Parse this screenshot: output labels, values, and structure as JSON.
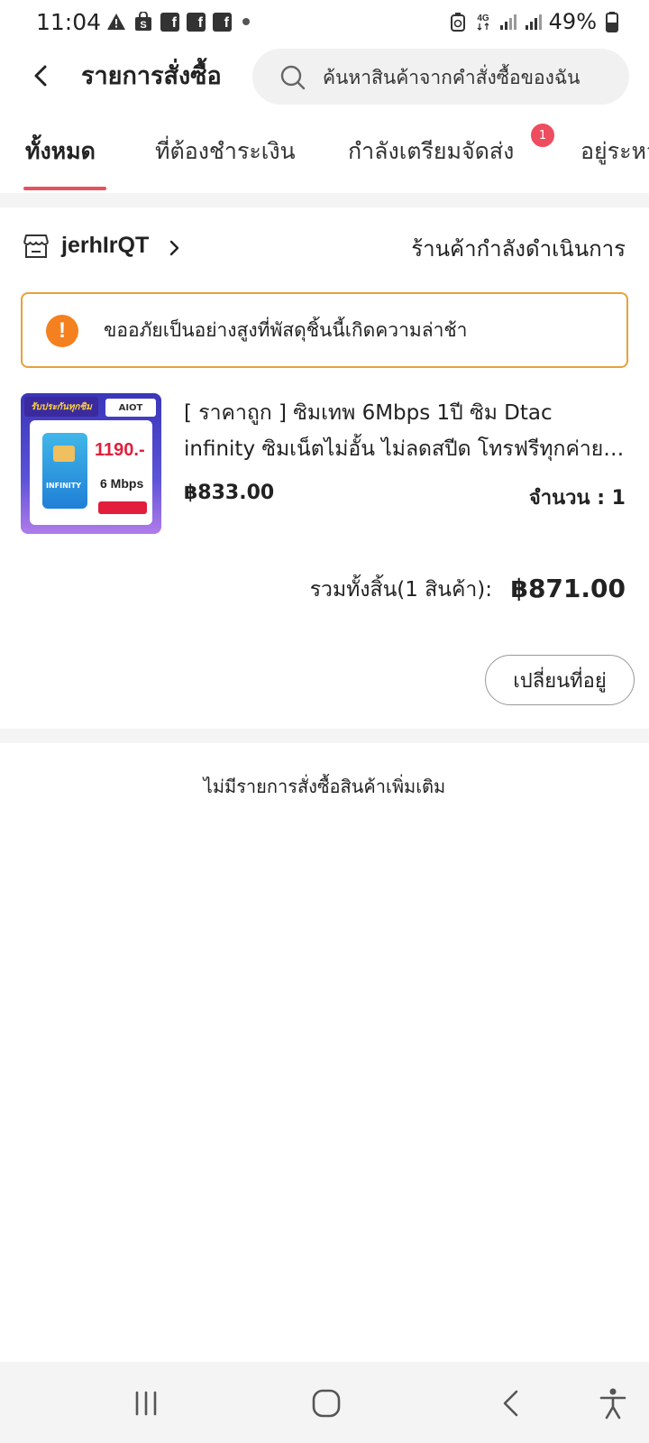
{
  "status_bar": {
    "time": "11:04",
    "battery": "49%",
    "network": "4G"
  },
  "header": {
    "title": "รายการสั่งซื้อ",
    "search_placeholder": "ค้นหาสินค้าจากคำสั่งซื้อของฉัน"
  },
  "tabs": [
    {
      "label": "ทั้งหมด",
      "active": true
    },
    {
      "label": "ที่ต้องชำระเงิน",
      "active": false
    },
    {
      "label": "กำลังเตรียมจัดส่ง",
      "active": false,
      "badge": "1"
    },
    {
      "label": "อยู่ระหว่างจัดส่ง",
      "active": false
    }
  ],
  "order": {
    "shop_name": "jerhIrQT",
    "shop_status": "ร้านค้ากำลังดำเนินการ",
    "delay_notice": "ขออภัยเป็นอย่างสูงที่พัสดุชิ้นนี้เกิดความล่าช้า",
    "product_image": {
      "banner": "รับประกันทุกซิม",
      "logo": "AIOT",
      "price": "1190.-",
      "sim_label": "INFINITY",
      "speed": "6 Mbps"
    },
    "product_title_line1": "[ ราคาถูก  ] ซิมเทพ 6Mbps 1ปี ซิม Dtac",
    "product_title_line2": "infinity ซิมเน็ตไม่อั้น ไม่ลดสปีด โทรฟรีทุกค่าย ...",
    "price": "฿833.00",
    "quantity": "จำนวน : 1",
    "total_label": "รวมทั้งสิ้น(1 สินค้า):",
    "total_value": "฿871.00",
    "change_address_label": "เปลี่ยนที่อยู่"
  },
  "footer_message": "ไม่มีรายการสั่งซื้อสินค้าเพิ่มเติม",
  "colors": {
    "accent": "#e8505b",
    "badge": "#ee4d5f",
    "warning_border": "#e8a13a",
    "warning_icon": "#f4801f"
  }
}
